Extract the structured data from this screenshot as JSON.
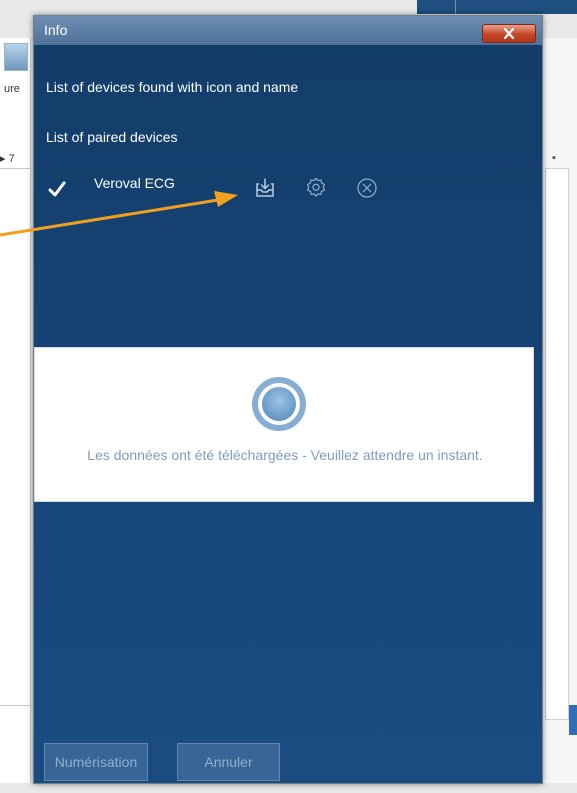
{
  "background": {
    "left_text_1": "ure",
    "left_text_2": "▸ 7"
  },
  "dialog": {
    "title": "Info",
    "found_devices_label": "List of devices found with icon and name",
    "paired_devices_label": "List of paired devices",
    "paired_devices": [
      {
        "name": "Veroval ECG",
        "status_icon": "checkmark-icon",
        "actions": [
          "download-icon",
          "settings-icon",
          "remove-icon"
        ]
      }
    ],
    "progress_message": "Les données ont été téléchargées - Veuillez attendre un instant.",
    "buttons": {
      "scan_label": "Numérisation",
      "cancel_label": "Annuler"
    }
  },
  "colors": {
    "dialog_background": "#17467a",
    "titlebar": "#5f82a8",
    "close_button": "#c6462a",
    "annotation_arrow": "#f0a020",
    "message_text": "#7c9cc4"
  }
}
